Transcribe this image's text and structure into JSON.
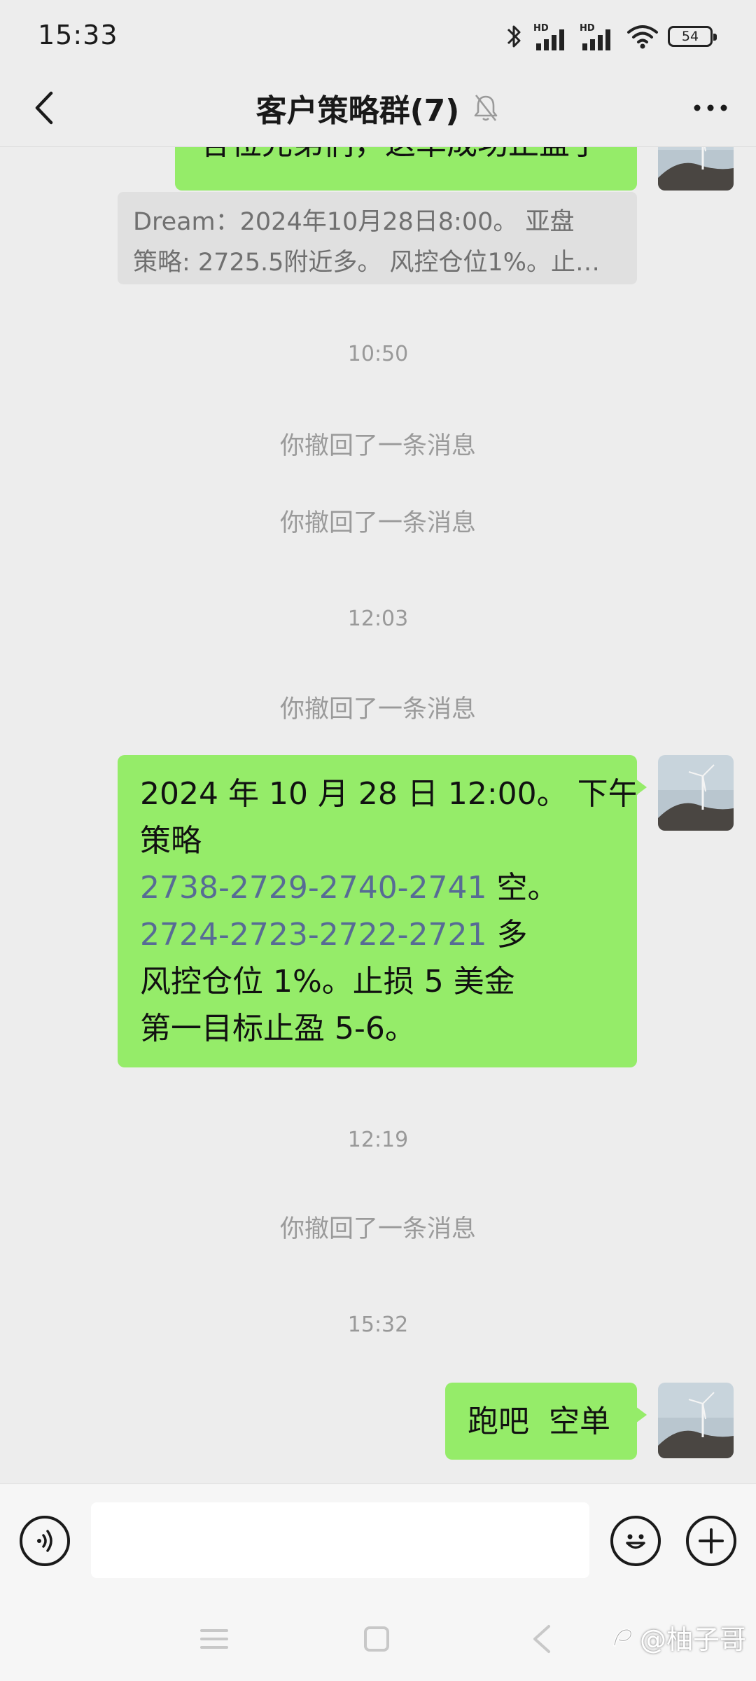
{
  "status_bar": {
    "time": "15:33",
    "battery": "54",
    "signal_badges": [
      "HD",
      "HD"
    ]
  },
  "header": {
    "title": "客户策略群(7)",
    "icons": [
      "back-arrow-icon",
      "mute-bell-icon",
      "more-dots-icon"
    ]
  },
  "messages": [
    {
      "type": "outgoing",
      "text": "各位兄弟们，这单成功止盈了",
      "partially_visible": true
    },
    {
      "type": "quote",
      "lines": [
        "Dream：2024年10月28日8:00。 亚盘",
        "策略: 2725.5附近多。 风控仓位1%。止…"
      ]
    },
    {
      "type": "time",
      "text": "10:50"
    },
    {
      "type": "recall",
      "text": "你撤回了一条消息"
    },
    {
      "type": "recall",
      "text": "你撤回了一条消息"
    },
    {
      "type": "time",
      "text": "12:03"
    },
    {
      "type": "recall",
      "text": "你撤回了一条消息"
    },
    {
      "type": "outgoing",
      "lines": [
        {
          "text": "2024 年 10 月 28 日 12:00。 下午"
        },
        {
          "text": "策略"
        },
        {
          "num": "2738-2729-2740-2741",
          "text": " 空。"
        },
        {
          "num": "2724-2723-2722-2721",
          "text": " 多"
        },
        {
          "text": "风控仓位 1%。止损 5 美金"
        },
        {
          "text": "第一目标止盈 5-6。"
        }
      ]
    },
    {
      "type": "time",
      "text": "12:19"
    },
    {
      "type": "recall",
      "text": "你撤回了一条消息"
    },
    {
      "type": "time",
      "text": "15:32"
    },
    {
      "type": "outgoing",
      "text": "跑吧  空单"
    }
  ],
  "input_bar": {
    "value": "",
    "icons": [
      "voice-icon",
      "emoji-icon",
      "plus-icon"
    ]
  },
  "watermark": "@柚子哥",
  "colors": {
    "bubble_outgoing": "#95ec69",
    "background": "#ededed",
    "link_number": "#576b95"
  }
}
